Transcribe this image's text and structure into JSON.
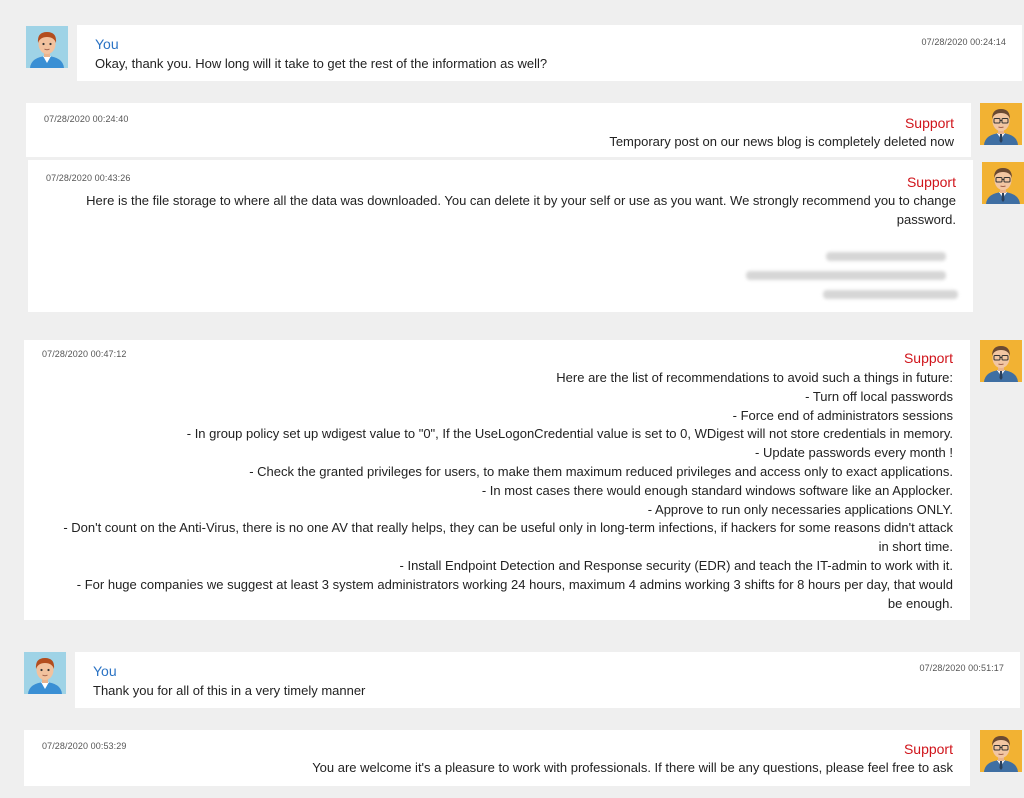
{
  "messages": [
    {
      "sender": "You",
      "timestamp": "07/28/2020 00:24:14",
      "text": "Okay, thank you. How long will it take to get the rest of the information as well?"
    },
    {
      "sender": "Support",
      "timestamp": "07/28/2020 00:24:40",
      "text": "Temporary post on our news blog is completely deleted now"
    },
    {
      "sender": "Support",
      "timestamp": "07/28/2020 00:43:26",
      "lines": [
        "Here is the file storage to where all the data was downloaded. You can delete it by your self or use as you want. We strongly recommend you to change",
        "password."
      ]
    },
    {
      "sender": "Support",
      "timestamp": "07/28/2020 00:47:12",
      "lines": [
        "Here are the list of recommendations to avoid such a things in future:",
        "- Turn off local passwords",
        "- Force end of administrators sessions",
        "- In group policy set up wdigest value to \"0\", If the UseLogonCredential value is set to 0, WDigest will not store credentials in memory.",
        "- Update passwords every month !",
        "- Check the granted privileges for users, to make them maximum reduced privileges and access only to exact applications.",
        "- In most cases there would enough standard windows software like an Applocker.",
        "- Approve to run only necessaries applications ONLY.",
        "- Don't count on the Anti-Virus, there is no one AV that really helps, they can be useful only in long-term infections, if hackers for some reasons didn't attack",
        "in short time.",
        "- Install Endpoint Detection and Response security (EDR) and teach the IT-admin to work with it.",
        "- For huge companies we suggest at least 3 system administrators working 24 hours, maximum 4 admins working 3 shifts for 8 hours per day, that would",
        "be enough."
      ]
    },
    {
      "sender": "You",
      "timestamp": "07/28/2020 00:51:17",
      "text": "Thank you for all of this in a very timely manner"
    },
    {
      "sender": "Support",
      "timestamp": "07/28/2020 00:53:29",
      "text": "You are welcome it's a pleasure to work with professionals. If there will be any questions, please feel free to ask"
    }
  ],
  "colors": {
    "background": "#efefef",
    "card": "#ffffff",
    "you_name": "#2b73c4",
    "support_name": "#d0141b",
    "text": "#222222"
  },
  "icons": {
    "user_avatar": "user-avatar-icon",
    "support_avatar": "support-avatar-icon"
  }
}
